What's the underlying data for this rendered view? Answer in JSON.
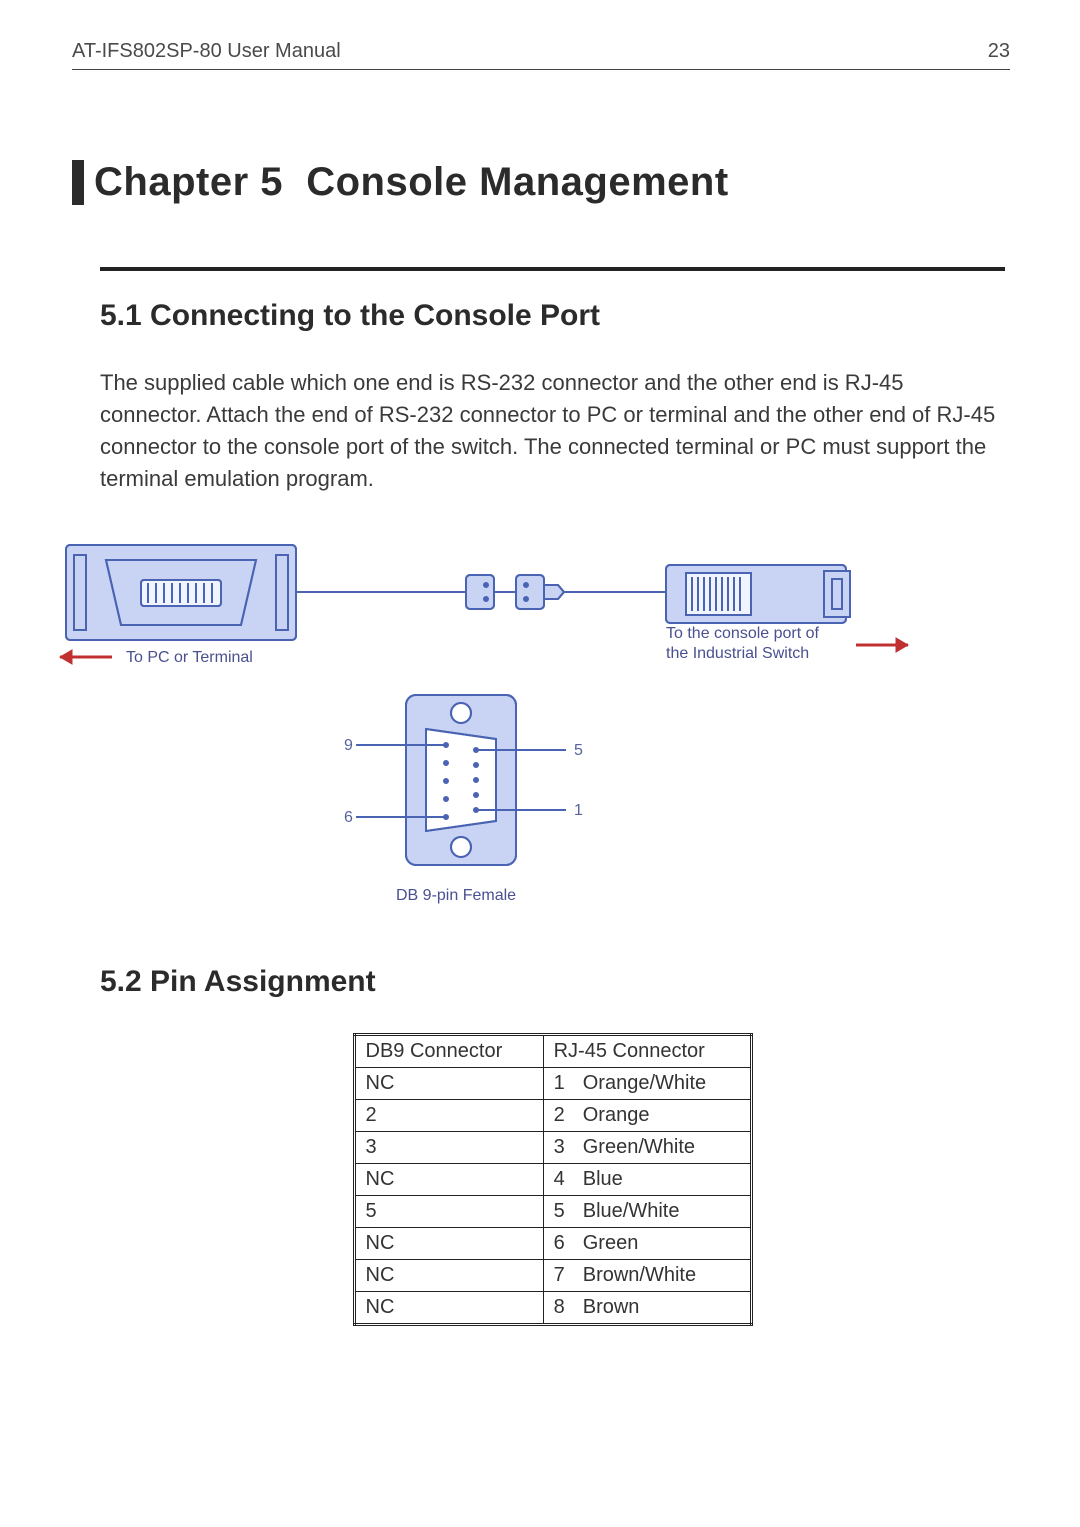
{
  "header": {
    "doc_title": "AT-IFS802SP-80 User Manual",
    "page_number": "23"
  },
  "chapter": {
    "label": "Chapter 5",
    "title": "Console Management"
  },
  "section_5_1": {
    "heading": "5.1  Connecting to the Console Port",
    "paragraph": "The supplied cable which one end is RS-232 connector and the other end is RJ-45 connector. Attach the end of RS-232 connector to PC or terminal and the other end of RJ-45 connector to the console port of the switch. The connected terminal or PC must support the terminal emulation program."
  },
  "diagram": {
    "left_label": "To PC or Terminal",
    "right_label_line1": "To the console port of",
    "right_label_line2": "the Industrial Switch",
    "pin_labels": {
      "tl": "9",
      "bl": "6",
      "tr": "5",
      "br": "1"
    },
    "caption": "DB 9-pin Female"
  },
  "section_5_2": {
    "heading": "5.2  Pin Assignment"
  },
  "pin_table": {
    "headers": {
      "db9": "DB9 Connector",
      "rj45": "RJ-45 Connector"
    },
    "rows": [
      {
        "db9": "NC",
        "rj_num": "1",
        "rj_color": "Orange/White"
      },
      {
        "db9": "2",
        "rj_num": "2",
        "rj_color": "Orange"
      },
      {
        "db9": "3",
        "rj_num": "3",
        "rj_color": "Green/White"
      },
      {
        "db9": "NC",
        "rj_num": "4",
        "rj_color": "Blue"
      },
      {
        "db9": "5",
        "rj_num": "5",
        "rj_color": "Blue/White"
      },
      {
        "db9": "NC",
        "rj_num": "6",
        "rj_color": "Green"
      },
      {
        "db9": "NC",
        "rj_num": "7",
        "rj_color": "Brown/White"
      },
      {
        "db9": "NC",
        "rj_num": "8",
        "rj_color": "Brown"
      }
    ]
  }
}
